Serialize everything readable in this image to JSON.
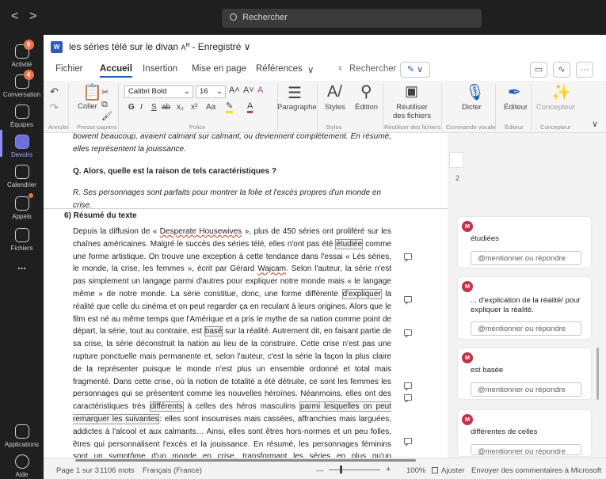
{
  "teams": {
    "search_placeholder": "Rechercher",
    "rail": [
      {
        "label": "Activité",
        "badge": "9"
      },
      {
        "label": "Conversation",
        "badge": "4"
      },
      {
        "label": "Équipes"
      },
      {
        "label": "Devoirs"
      },
      {
        "label": "Calendrier"
      },
      {
        "label": "Appels"
      },
      {
        "label": "Fichiers"
      },
      {
        "label": "..."
      },
      {
        "label": "Applications"
      },
      {
        "label": "Aide"
      }
    ],
    "nav_back": "<",
    "nav_forward": ">"
  },
  "word": {
    "title": "les séries télé sur le divan",
    "title_suffix": "- Enregistré",
    "menu": [
      "Fichier",
      "Accueil",
      "Insertion",
      "Mise en page",
      "Références"
    ],
    "search_label": "Rechercher",
    "ribbon": {
      "paste": "Coller",
      "font_name": "Calibri Bold",
      "font_size": "16",
      "paragraph": "Paragraphe",
      "styles": "Styles",
      "edition": "Édition",
      "reuse": "Réutiliser des fichiers",
      "dictate": "Dicter",
      "editor": "Éditeur",
      "designer": "Concepteur",
      "groups": {
        "undo": "Annuler",
        "clipboard": "Presse-papiers",
        "font": "Police",
        "styles": "Styles",
        "reuse": "Réutiliser des fichiers",
        "voice": "Commande vocale",
        "editor": "Éditeur",
        "designer": "Concepteur"
      },
      "format_buttons": [
        "G",
        "I",
        "S",
        "ab",
        "x₂",
        "x²",
        "Aa"
      ]
    },
    "document": {
      "top_fragment": "bowent beaucoup, avaient calmant sur calmant, ou deviennent complètement. En résumé, elles représentent la jouissance.",
      "question": "Q. Alors, quelle est la raison de tels caractéristiques ?",
      "answer": "R. Ses personnages sont parfaits pour montrer la folie et l'excès propres d'un monde en crise.",
      "page_number": "2",
      "section_title": "6) Résumé du texte",
      "paragraph": [
        {
          "t": "Depuis la diffusion de « "
        },
        {
          "t": "Desperate Housewives",
          "cls": "u"
        },
        {
          "t": " », plus de 450 séries ont proliféré sur les chaînes américaines. Malgré le succès des séries télé, elles n'ont pas été "
        },
        {
          "t": "étudiée",
          "cls": "hl"
        },
        {
          "t": " comme une forme artistique. On trouve une exception à cette tendance dans l'essai « Lés séries, le monde, la crise, les femmes », écrit par Gérard "
        },
        {
          "t": "Wajcam",
          "cls": "u"
        },
        {
          "t": ". Selon l'auteur, la série n'est pas simplement un langage parmi d'autres pour expliquer notre monde mais « le langage même » de notre monde. La série constitue, donc, une forme différente "
        },
        {
          "t": "d'expliquer",
          "cls": "hl"
        },
        {
          "t": " la réalité que celle du cinéma et on peut regarder ça en reculant à leurs origines. Alors que le film est né au même temps que l'Amérique et a pris le mythe de sa nation comme point de départ, la série, tout au contraire, est "
        },
        {
          "t": "basé",
          "cls": "hl"
        },
        {
          "t": " sur la réalité. Autrement dit, en faisant partie de sa crise, la série déconstruit la nation au lieu de la construire. Cette crise n'est pas une rupture ponctuelle mais permanente et, selon l'auteur, c'est la série la façon la plus claire de la représenter puisque le monde n'est plus un ensemble ordonné et total mais fragmenté. Dans cette crise, où la notion de totalité a été détruite, ce sont les femmes les personnages qui se présentent comme les nouvelles héroïnes. Néanmoins, elles ont des caractéristiques très "
        },
        {
          "t": "différents",
          "cls": "hl"
        },
        {
          "t": " à celles des héros masculins "
        },
        {
          "t": "parmi lesquelles on peut remarquer les suivantes",
          "cls": "hl"
        },
        {
          "t": ": elles sont insoumises mais cassées, affranchies mais larguées, addictes à l'alcool et aux calmants… Ainsi, elles sont êtres hors-normes et un peu folles, êtres qui personnalisent l'excès et la jouissance. En résumé, les personnages féminins sont un symptôme d'un monde en crise, transformant les séries en plus qu'un divertissement."
        }
      ]
    },
    "comments": [
      {
        "avatar": "M",
        "text": "étudiées",
        "reply": "@mentionner ou répondre"
      },
      {
        "avatar": "M",
        "text": "... d'explication de la réalité/ pour expliquer la réalité.",
        "reply": "@mentionner ou répondre"
      },
      {
        "avatar": "M",
        "text": "est basée",
        "reply": "@mentionner ou répondre"
      },
      {
        "avatar": "M",
        "text": "différentes de celles",
        "reply": "@mentionner ou répondre"
      }
    ],
    "status": {
      "page": "Page 1 sur 3",
      "words": "1106 mots",
      "language": "Français (France)",
      "zoom": "100%",
      "fit": "Ajuster",
      "feedback": "Envoyer des commentaires à Microsoft"
    }
  }
}
